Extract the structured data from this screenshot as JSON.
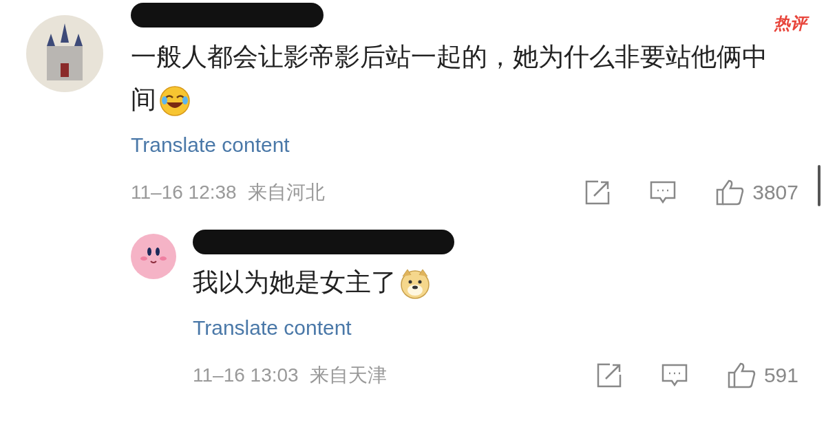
{
  "comments": [
    {
      "kind": "top",
      "badge": "热评",
      "text": "一般人都会让影帝影后站一起的，她为什么非要站他俩中间",
      "emoji": {
        "kind": "laughing"
      },
      "avatar": {
        "kind": "castle"
      },
      "translate": "Translate content",
      "date": "11–16 12:38",
      "location": "来自河北",
      "likes": "3807"
    },
    {
      "kind": "reply",
      "text": "我以为她是女主了",
      "emoji": {
        "kind": "doge"
      },
      "avatar": {
        "kind": "character"
      },
      "translate": "Translate content",
      "date": "11–16 13:03",
      "location": "来自天津",
      "likes": "591"
    }
  ]
}
